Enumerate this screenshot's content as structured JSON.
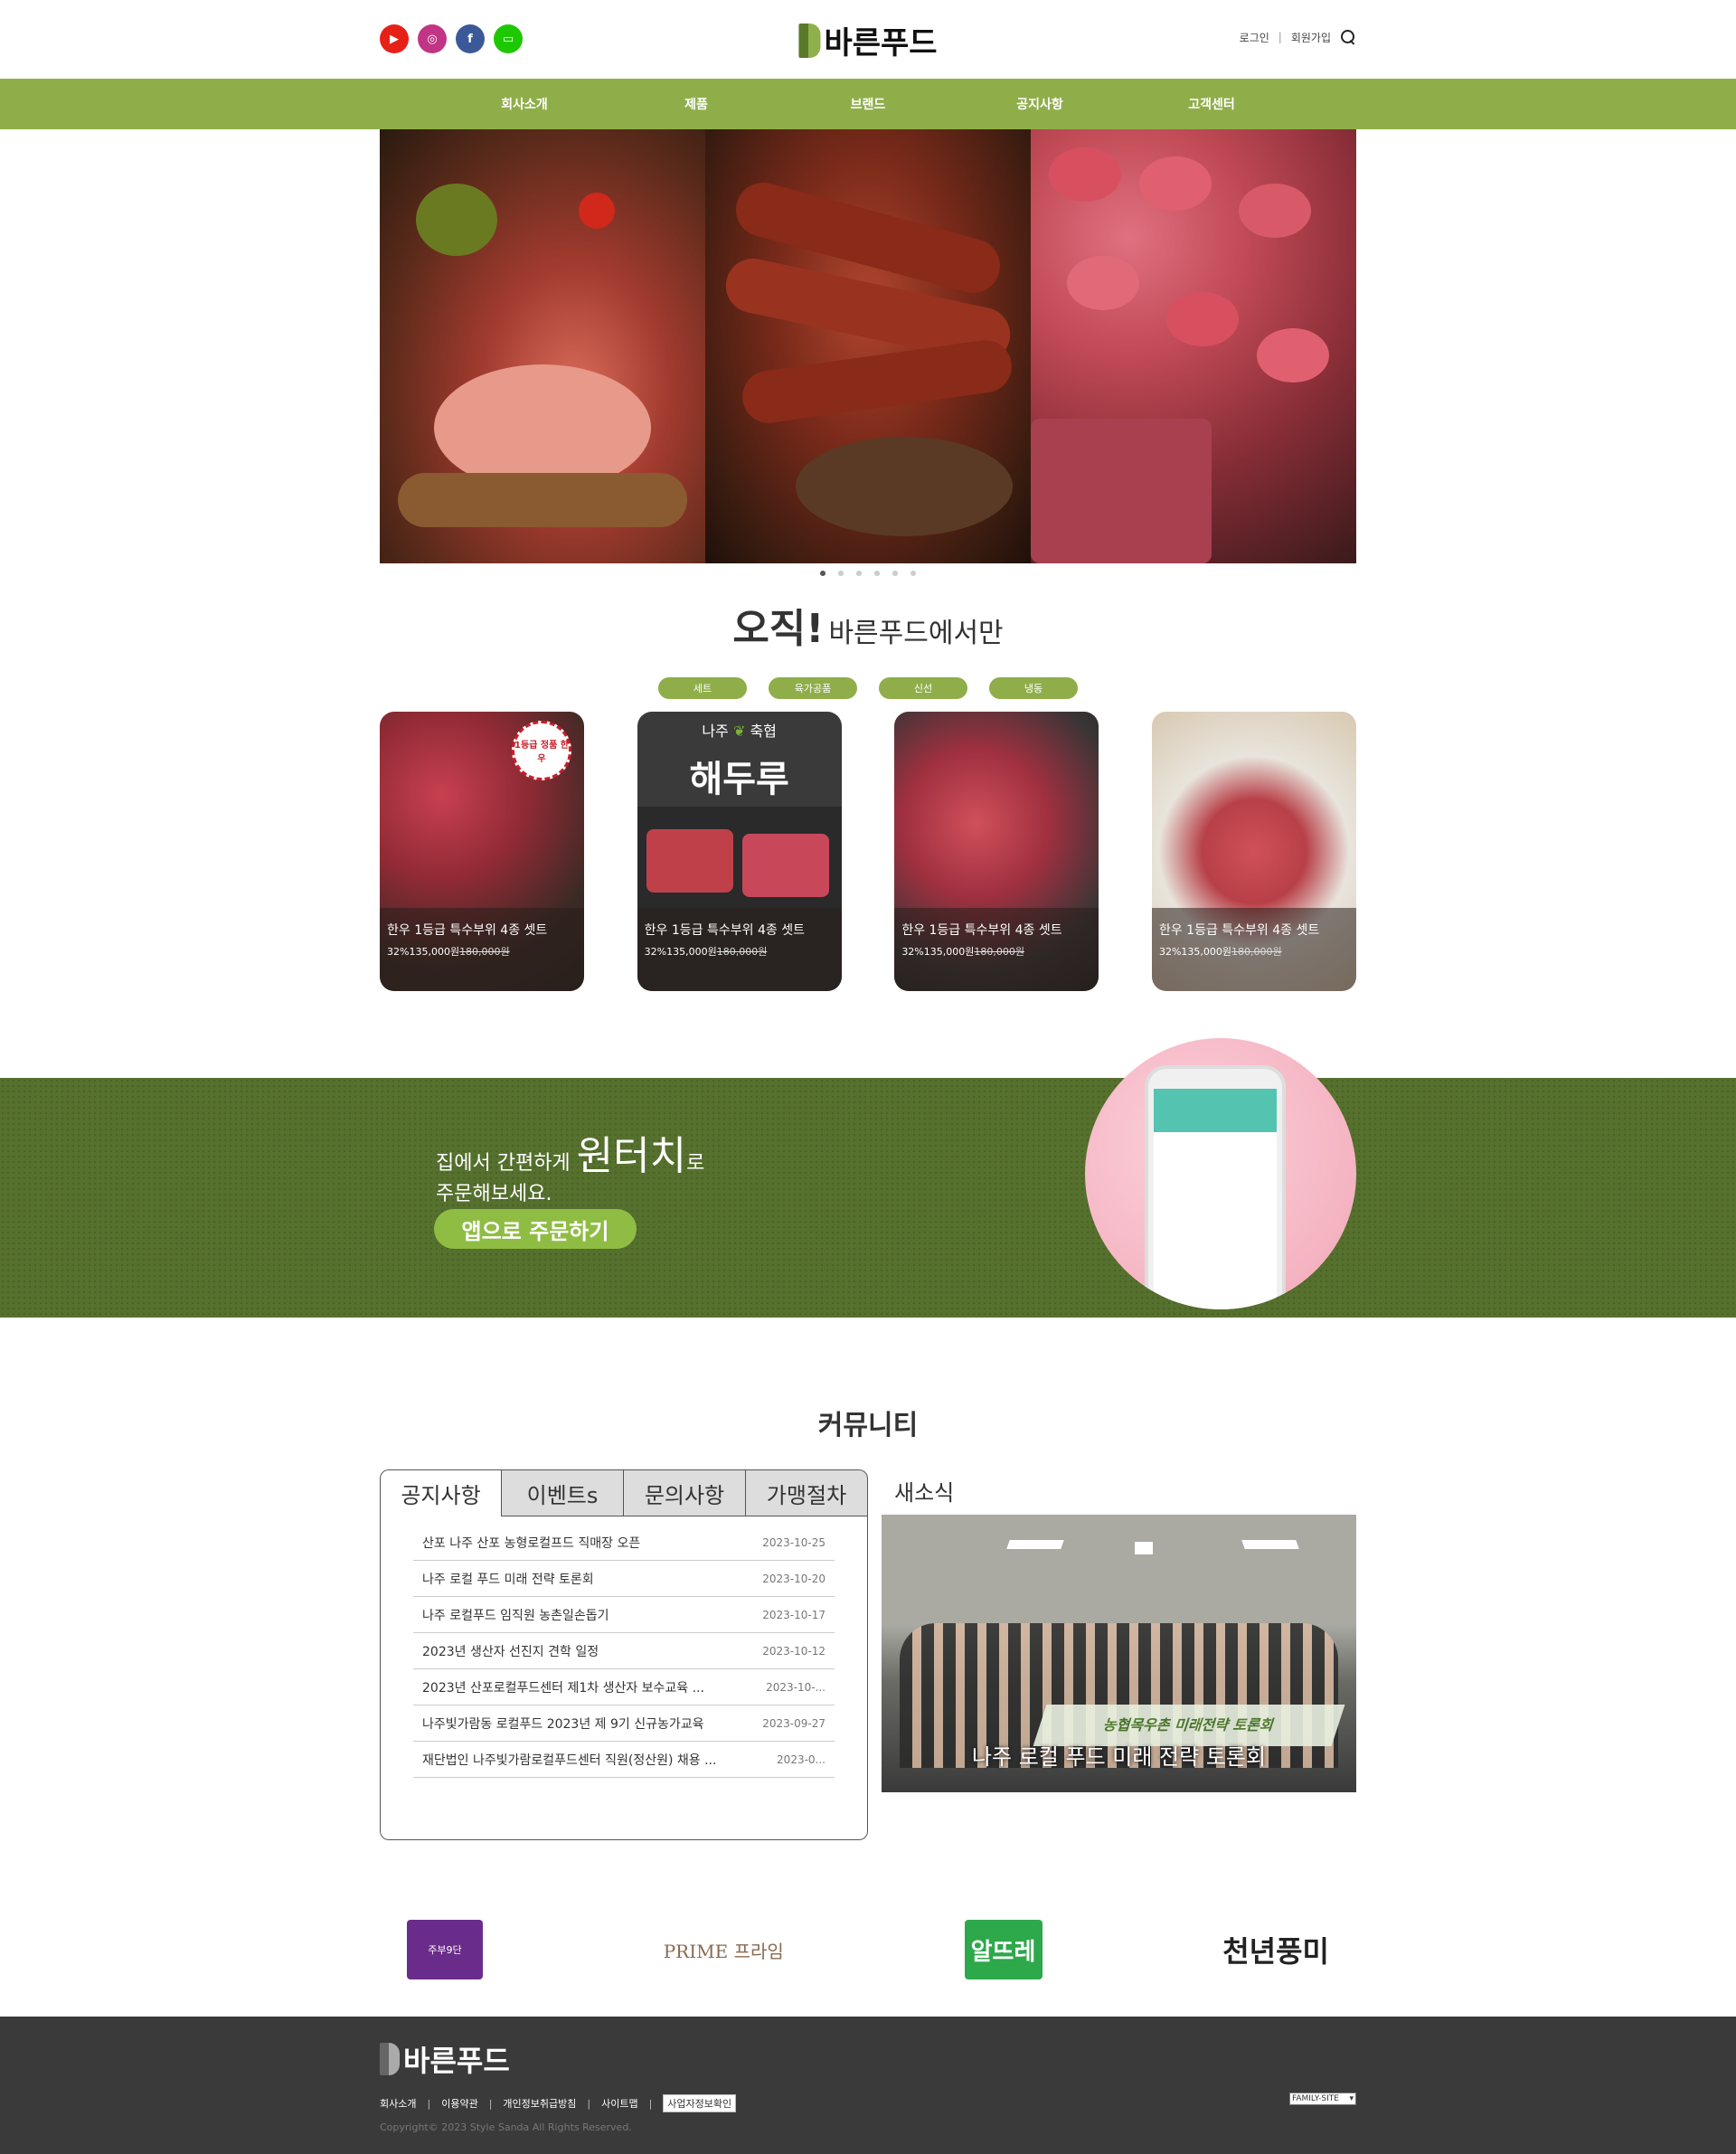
{
  "header": {
    "logo_text": "바른푸드",
    "socials": [
      "youtube-icon",
      "instagram-icon",
      "facebook-icon",
      "kakaotalk-icon"
    ],
    "social_colors": [
      "#e62117",
      "#c13584",
      "#3b5998",
      "#1ec800"
    ],
    "login": "로그인",
    "signup": "회원가입"
  },
  "nav": [
    "회사소개",
    "제품",
    "브랜드",
    "공지사항",
    "고객센터"
  ],
  "hero": {
    "slide_count": 6,
    "active_slide": 1
  },
  "only_section": {
    "title_big": "오직!",
    "title_small": "바른푸드에서만",
    "categories": [
      "세트",
      "육가공품",
      "신선",
      "냉동"
    ]
  },
  "products": [
    {
      "name": "한우 1등급 특수부위 4종 셋트",
      "discount": "32%",
      "price": "135,000원",
      "old_price": "180,000원",
      "badge": "1등급 정품 한우"
    },
    {
      "name": "한우 1등급 특수부위 4종 셋트",
      "discount": "32%",
      "price": "135,000원",
      "old_price": "180,000원",
      "brand_top": "나주",
      "brand_mark": "축협",
      "brand_big": "해두루"
    },
    {
      "name": "한우 1등급 특수부위 4종 셋트",
      "discount": "32%",
      "price": "135,000원",
      "old_price": "180,000원"
    },
    {
      "name": "한우 1등급 특수부위 4종 셋트",
      "discount": "32%",
      "price": "135,000원",
      "old_price": "180,000원"
    }
  ],
  "app_banner": {
    "line1_pre": "집에서 간편하게 ",
    "line1_em": "원터치",
    "line1_post": "로",
    "line2": "주문해보세요.",
    "button": "앱으로 주문하기"
  },
  "community": {
    "title": "커뮤니티",
    "tabs": [
      "공지사항",
      "이벤트s",
      "문의사항",
      "가맹절차"
    ],
    "rows": [
      {
        "title": "산포 나주 산포 농형로컬프드 직매장 오픈",
        "date": "2023-10-25"
      },
      {
        "title": "나주 로컬 푸드 미래 전략 토론회",
        "date": "2023-10-20"
      },
      {
        "title": "나주 로컬푸드 임직원 농촌일손돕기",
        "date": "2023-10-17"
      },
      {
        "title": "2023년 생산자 선진지 견학 일정",
        "date": "2023-10-12"
      },
      {
        "title": "2023년 산포로컬푸드센터 제1차 생산자 보수교육 ...",
        "date": "2023-10-..."
      },
      {
        "title": "나주빛가람동 로컬푸드 2023년 제 9기 신규농가교육",
        "date": "2023-09-27"
      },
      {
        "title": "재단법인 나주빛가람로컬푸드센터 직원(정산원) 채용 ...",
        "date": "2023-0..."
      }
    ],
    "news_title": "새소식",
    "news_caption": "나주 로컬 푸드 미래 전략 토론회",
    "news_banner": "농협목우촌 미래전략 토론회"
  },
  "partners": [
    {
      "text": "주부9단"
    },
    {
      "text": "PRIME 프라임"
    },
    {
      "text": "알뜨레"
    },
    {
      "text": "천년풍미"
    }
  ],
  "footer": {
    "logo_text": "바른푸드",
    "links": [
      "회사소개",
      "이용약관",
      "개인정보취급방침",
      "사이트맵"
    ],
    "biz_info": "사업자정보확인",
    "copyright": "Copyright© 2023 Style Sanda All Rights Reserved.",
    "family_site": "FAMILY-SITE"
  },
  "colors": {
    "accent": "#8fae4a",
    "banner": "#56702e",
    "footer": "#3a3a3a"
  }
}
